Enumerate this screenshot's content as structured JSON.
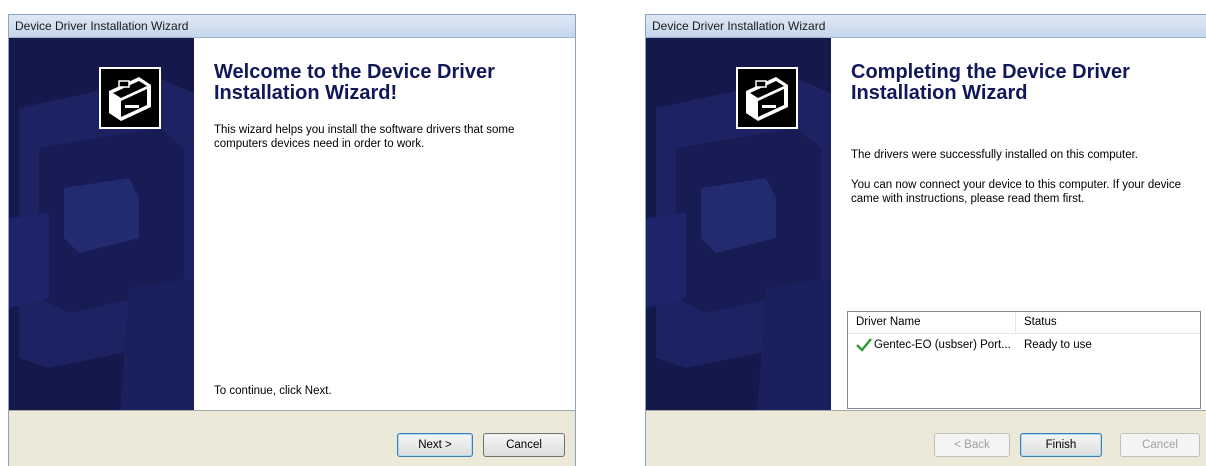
{
  "colors": {
    "side_panel": "#14184a",
    "heading": "#10185a",
    "check": "#2e9c2e",
    "footer": "#ece9d8"
  },
  "wizard1": {
    "title": "Device Driver Installation Wizard",
    "heading": "Welcome to the Device Driver Installation Wizard!",
    "description": "This wizard helps you install the software drivers that some computers devices need in order to work.",
    "continue_text": "To continue, click Next.",
    "next_button": "Next >",
    "cancel_button": "Cancel",
    "logo_icon": "device-box-icon"
  },
  "wizard2": {
    "title": "Device Driver Installation Wizard",
    "heading": "Completing the Device Driver Installation Wizard",
    "success_text": "The drivers were successfully installed on this computer.",
    "connect_text": "You can now connect your device to this computer. If your device came with instructions, please read them first.",
    "table": {
      "headers": [
        "Driver Name",
        "Status"
      ],
      "rows": [
        {
          "name": "Gentec-EO (usbser) Port...",
          "status": "Ready to use",
          "icon": "check-icon"
        }
      ]
    },
    "back_button": "< Back",
    "finish_button": "Finish",
    "cancel_button": "Cancel",
    "logo_icon": "device-box-icon"
  }
}
